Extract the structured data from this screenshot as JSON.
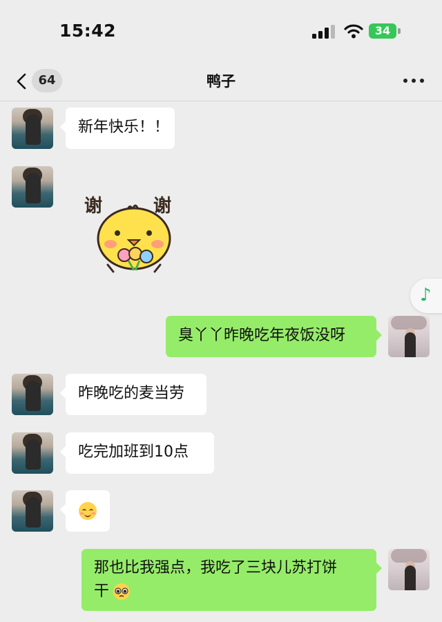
{
  "status_bar": {
    "time": "15:42",
    "battery": "34"
  },
  "nav": {
    "unread_count": "64",
    "title": "鸭子"
  },
  "sticker": {
    "left_text": "谢",
    "right_text": "谢"
  },
  "messages": [
    {
      "from": "friend",
      "text": "新年快乐！！"
    },
    {
      "from": "friend",
      "type": "sticker"
    },
    {
      "from": "me",
      "text": "臭丫丫昨晚吃年夜饭没呀"
    },
    {
      "from": "friend",
      "text": "昨晚吃的麦当劳"
    },
    {
      "from": "friend",
      "text": "吃完加班到10点"
    },
    {
      "from": "friend",
      "type": "emoji",
      "emoji": "smiling-face-icon"
    },
    {
      "from": "me",
      "line1": "那也比我强点，我吃了三块儿苏打饼",
      "line2": "干"
    }
  ],
  "icons": {
    "back": "chevron-left-icon",
    "more": "more-dots-icon",
    "music": "music-note-icon"
  },
  "colors": {
    "my_bubble": "#95ec69",
    "friend_bubble": "#ffffff",
    "background": "#ededed"
  }
}
